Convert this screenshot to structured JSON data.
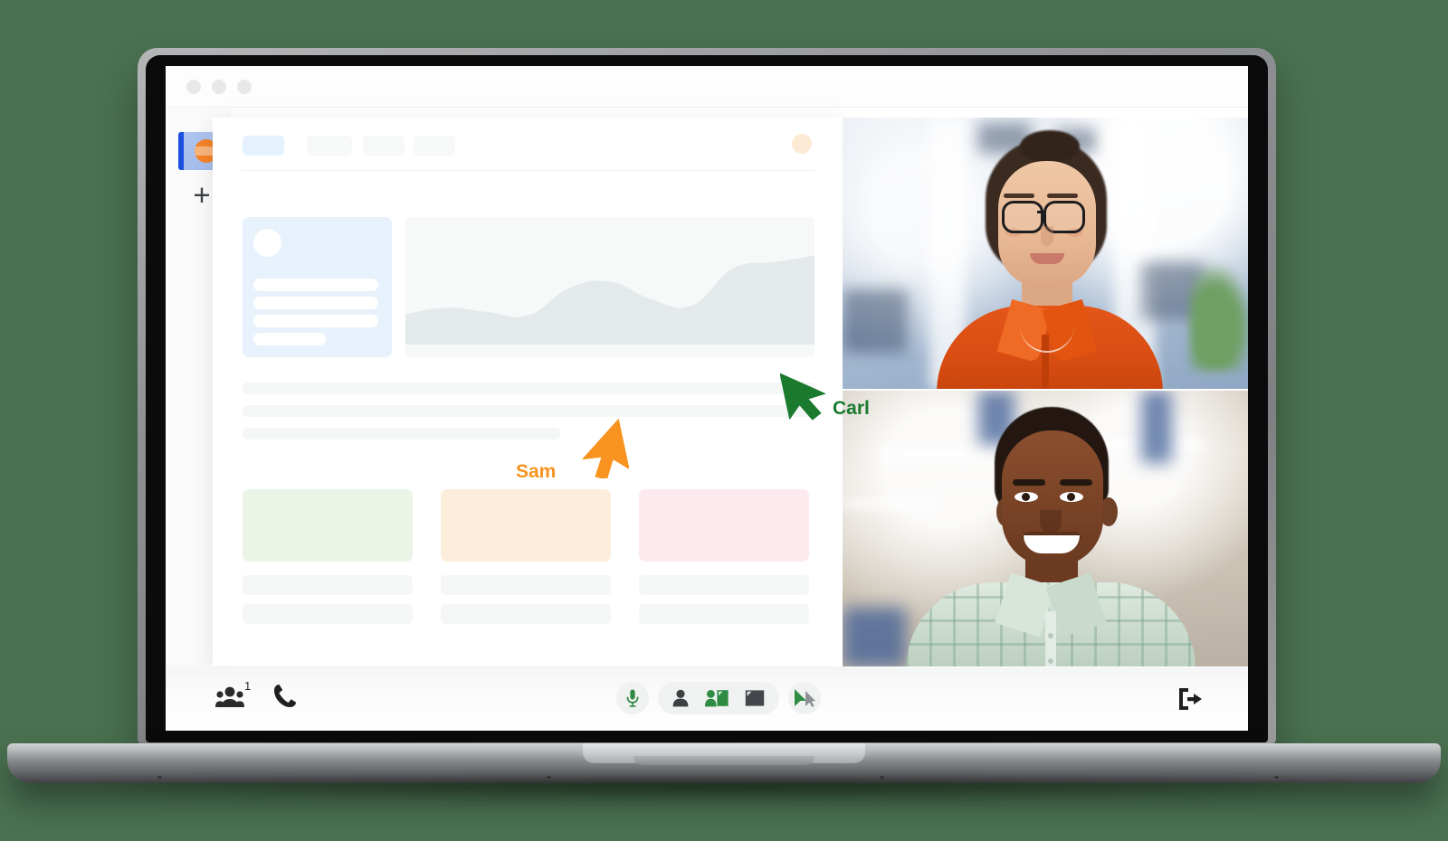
{
  "scene": {
    "background_color": "#4a7150",
    "device": "laptop-mockup"
  },
  "browser": {
    "traffic_lights": [
      "close",
      "minimize",
      "maximize"
    ],
    "traffic_light_color": "#e8e8e8"
  },
  "app_sidebar": {
    "app_icon_name": "workspace-app-icon",
    "app_icon_colors": {
      "tile": "#aec4ef",
      "indicator": "#1b4fe0",
      "mark": "#f5832a"
    },
    "add_button_label": "+"
  },
  "app_window": {
    "topnav": {
      "items": [
        {
          "name": "nav-tab-active",
          "state": "active",
          "color": "#e5f1fc"
        },
        {
          "name": "nav-tab-2",
          "state": "idle",
          "color": "#f7f8f8"
        },
        {
          "name": "nav-tab-3",
          "state": "idle",
          "color": "#f7f8f8"
        },
        {
          "name": "nav-tab-4",
          "state": "idle",
          "color": "#f7f8f8"
        }
      ],
      "avatar_color": "#fdead4"
    },
    "profile_card": {
      "background": "#e7f2fd",
      "avatar_color": "#ffffff",
      "placeholder_lines": 4
    },
    "tiles": [
      {
        "name": "tile-green",
        "color": "#eaf5e7"
      },
      {
        "name": "tile-orange",
        "color": "#fdeedb"
      },
      {
        "name": "tile-pink",
        "color": "#fceaef"
      }
    ],
    "skeleton_rows": 3
  },
  "chart_data": {
    "type": "area",
    "title": "",
    "xlabel": "",
    "ylabel": "",
    "x": [
      0,
      1,
      2,
      3,
      4,
      5,
      6,
      7,
      8,
      9,
      10
    ],
    "values": [
      28,
      34,
      30,
      27,
      52,
      58,
      42,
      36,
      70,
      76,
      82
    ],
    "ylim": [
      0,
      100
    ],
    "grid": false,
    "legend": "none",
    "area_color": "#e4eaec",
    "background_color": "#f7f9f9"
  },
  "video_tiles": [
    {
      "name": "video-participant-1",
      "description": "Woman with glasses in orange blouse, blurred office background",
      "shirt_color": "#e4561a"
    },
    {
      "name": "video-participant-2",
      "description": "Smiling man in light green plaid shirt, blurred warehouse background",
      "shirt_color": "#cadbcd"
    }
  ],
  "cursors": [
    {
      "name": "cursor-carl",
      "label": "Carl",
      "color": "#1a7a2e",
      "direction": "up-left"
    },
    {
      "name": "cursor-sam",
      "label": "Sam",
      "color": "#f7931e",
      "direction": "up-right"
    }
  ],
  "meeting_bar": {
    "participants_icon": "people-icon",
    "participants_count": "1",
    "call_icon": "phone-icon",
    "controls": [
      {
        "name": "microphone-button",
        "icon": "microphone-icon",
        "color": "#2e8b42",
        "state": "on"
      },
      {
        "name": "camera-person-button",
        "icon": "person-icon",
        "color": "#3c4043"
      },
      {
        "name": "present-with-person-button",
        "icon": "person-screen-icon",
        "color": "#2e8b42"
      },
      {
        "name": "share-screen-button",
        "icon": "screen-icon",
        "color": "#43464a"
      },
      {
        "name": "pointer-button",
        "icon": "cursor-pointer-icon",
        "color": "#2e8b42"
      }
    ],
    "leave_button": {
      "name": "leave-meeting-button",
      "icon": "exit-icon",
      "color": "#1f1f1f"
    }
  }
}
